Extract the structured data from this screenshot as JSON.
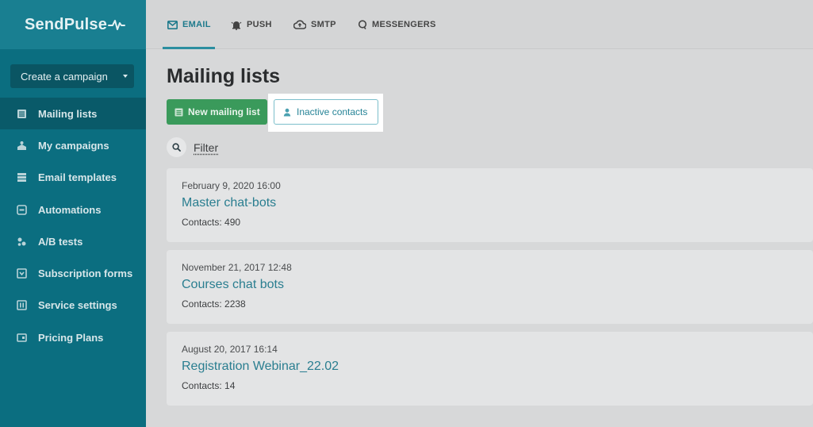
{
  "brand": {
    "name": "SendPulse"
  },
  "sidebar": {
    "create_button": "Create a campaign",
    "items": [
      {
        "label": "Mailing lists",
        "icon": "list-icon",
        "active": true
      },
      {
        "label": "My campaigns",
        "icon": "campaigns-icon",
        "active": false
      },
      {
        "label": "Email templates",
        "icon": "templates-icon",
        "active": false
      },
      {
        "label": "Automations",
        "icon": "automations-icon",
        "active": false
      },
      {
        "label": "A/B tests",
        "icon": "ab-tests-icon",
        "active": false
      },
      {
        "label": "Subscription forms",
        "icon": "forms-icon",
        "active": false
      },
      {
        "label": "Service settings",
        "icon": "settings-icon",
        "active": false
      },
      {
        "label": "Pricing Plans",
        "icon": "pricing-icon",
        "active": false
      }
    ]
  },
  "topnav": {
    "tabs": [
      {
        "label": "EMAIL",
        "icon": "email-icon",
        "active": true
      },
      {
        "label": "PUSH",
        "icon": "bell-icon",
        "active": false
      },
      {
        "label": "SMTP",
        "icon": "cloud-icon",
        "active": false
      },
      {
        "label": "MESSENGERS",
        "icon": "chat-icon",
        "active": false
      }
    ]
  },
  "main": {
    "title": "Mailing lists",
    "new_list_button": "New mailing list",
    "inactive_button": "Inactive contacts",
    "filter_label": "Filter",
    "lists": [
      {
        "date": "February 9, 2020 16:00",
        "name": "Master chat-bots",
        "contacts": "Contacts: 490"
      },
      {
        "date": "November 21, 2017 12:48",
        "name": "Courses chat bots",
        "contacts": "Contacts: 2238"
      },
      {
        "date": "August 20, 2017 16:14",
        "name": "Registration Webinar_22.02",
        "contacts": "Contacts: 14"
      }
    ]
  },
  "colors": {
    "sidebar": "#0b6e80",
    "accent": "#2a7e90",
    "primary_button": "#3a9a5b"
  }
}
